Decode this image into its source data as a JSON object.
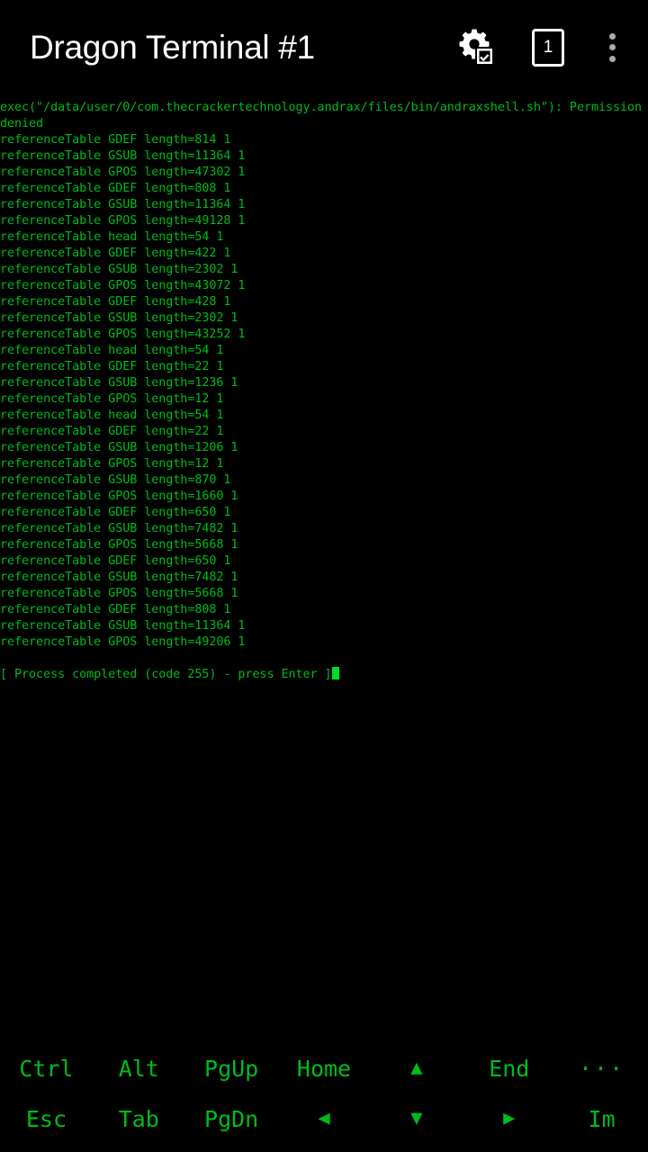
{
  "appbar": {
    "title": "Dragon Terminal #1",
    "settings_icon": "gear-checklist-icon",
    "tab_count": "1",
    "overflow_icon": "three-dots-vertical-icon"
  },
  "terminal": {
    "text_color": "#00bb1a",
    "background_color": "#000000",
    "cursor": "block",
    "lines": [
      "exec(\"/data/user/0/com.thecrackertechnology.andrax/files/bin/andraxshell.sh\"): Permission",
      "denied",
      "referenceTable GDEF length=814 1",
      "referenceTable GSUB length=11364 1",
      "referenceTable GPOS length=47302 1",
      "referenceTable GDEF length=808 1",
      "referenceTable GSUB length=11364 1",
      "referenceTable GPOS length=49128 1",
      "referenceTable head length=54 1",
      "referenceTable GDEF length=422 1",
      "referenceTable GSUB length=2302 1",
      "referenceTable GPOS length=43072 1",
      "referenceTable GDEF length=428 1",
      "referenceTable GSUB length=2302 1",
      "referenceTable GPOS length=43252 1",
      "referenceTable head length=54 1",
      "referenceTable GDEF length=22 1",
      "referenceTable GSUB length=1236 1",
      "referenceTable GPOS length=12 1",
      "referenceTable head length=54 1",
      "referenceTable GDEF length=22 1",
      "referenceTable GSUB length=1206 1",
      "referenceTable GPOS length=12 1",
      "referenceTable GSUB length=870 1",
      "referenceTable GPOS length=1660 1",
      "referenceTable GDEF length=650 1",
      "referenceTable GSUB length=7482 1",
      "referenceTable GPOS length=5668 1",
      "referenceTable GDEF length=650 1",
      "referenceTable GSUB length=7482 1",
      "referenceTable GPOS length=5668 1",
      "referenceTable GDEF length=808 1",
      "referenceTable GSUB length=11364 1",
      "referenceTable GPOS length=49206 1",
      "",
      "[ Process completed (code 255) - press Enter ]"
    ],
    "status_line": "[ Process completed (code 255) - press Enter ]"
  },
  "keybar": {
    "row1": [
      {
        "label": "Ctrl",
        "name": "key-ctrl"
      },
      {
        "label": "Alt",
        "name": "key-alt"
      },
      {
        "label": "PgUp",
        "name": "key-pgup"
      },
      {
        "label": "Home",
        "name": "key-home"
      },
      {
        "label": "▲",
        "name": "key-arrow-up"
      },
      {
        "label": "End",
        "name": "key-end"
      },
      {
        "label": "···",
        "name": "key-more"
      }
    ],
    "row2": [
      {
        "label": "Esc",
        "name": "key-esc"
      },
      {
        "label": "Tab",
        "name": "key-tab"
      },
      {
        "label": "PgDn",
        "name": "key-pgdn"
      },
      {
        "label": "◀",
        "name": "key-arrow-left"
      },
      {
        "label": "▼",
        "name": "key-arrow-down"
      },
      {
        "label": "▶",
        "name": "key-arrow-right"
      },
      {
        "label": "Im",
        "name": "key-ime"
      }
    ]
  }
}
